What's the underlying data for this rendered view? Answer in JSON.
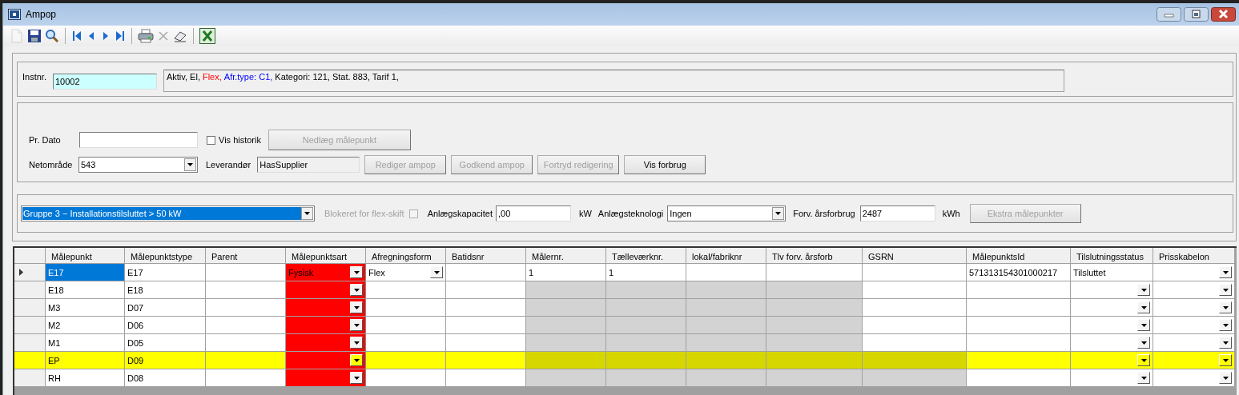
{
  "window": {
    "title": "Ampop"
  },
  "toolbar": [
    {
      "kind": "new",
      "disabled": true
    },
    {
      "kind": "save",
      "disabled": false
    },
    {
      "kind": "search",
      "disabled": false
    },
    {
      "kind": "separator"
    },
    {
      "kind": "first",
      "disabled": false
    },
    {
      "kind": "prev",
      "disabled": false
    },
    {
      "kind": "next",
      "disabled": false
    },
    {
      "kind": "last",
      "disabled": false
    },
    {
      "kind": "separator"
    },
    {
      "kind": "print",
      "disabled": false
    },
    {
      "kind": "delete",
      "disabled": true
    },
    {
      "kind": "eraser",
      "disabled": false
    },
    {
      "kind": "separator"
    },
    {
      "kind": "excel",
      "disabled": false
    }
  ],
  "installation": {
    "label": "Instnr.",
    "value": "10002",
    "summary": [
      {
        "text": "Aktiv, El,",
        "color": "#000000"
      },
      {
        "text": "Flex,",
        "color": "#ff0000"
      },
      {
        "text": "Afr.type: C1,",
        "color": "#0000ff"
      },
      {
        "text": "Kategori: 121, Stat. 883, Tarif 1,",
        "color": "#000000"
      }
    ]
  },
  "meter_point": {
    "date_label": "Pr. Dato",
    "history": {
      "label": "Vis historik",
      "checked": false
    },
    "close_button": {
      "label": "Nedlæg målepunkt",
      "disabled": true
    },
    "area_label": "Netområde",
    "area_value": "543",
    "supplier_label": "Leverandør",
    "supplier_value": "HasSupplier",
    "buttons": [
      {
        "label": "Rediger ampop",
        "disabled": true
      },
      {
        "label": "Godkend ampop",
        "disabled": true
      },
      {
        "label": "Fortryd redigering",
        "disabled": true
      },
      {
        "label": "Vis forbrug",
        "disabled": false
      }
    ]
  },
  "installation_details": {
    "group": "Gruppe 3 − Installationstilsluttet > 50 kW",
    "blocked": {
      "label": "Blokeret for flex-skift",
      "checked": false,
      "disabled": true
    },
    "capacity_label": "Anlægskapacitet",
    "capacity_value": ",00",
    "capacity_unit": "kW",
    "technology_label": "Anlægsteknologi",
    "technology_value": "Ingen",
    "consumption_label": "Forv. årsforbrug",
    "consumption_value": "2487",
    "consumption_unit": "kWh",
    "extra_button": {
      "label": "Ekstra målepunkter",
      "disabled": true
    }
  },
  "table": {
    "columns": [
      "Målepunkt",
      "Målepunktstype",
      "Parent",
      "Målepunktsart",
      "Afregningsform",
      "Batidsnr",
      "Målernr.",
      "Tælleværknr.",
      "lokal/fabriknr",
      "Tlv forv. årsforb",
      "GSRN",
      "MålepunktsId",
      "Tilslutningsstatus",
      "Prisskabelon"
    ],
    "rows": [
      {
        "current": true,
        "highlighted": false,
        "cells": [
          {
            "text": "E17",
            "selected": true,
            "disabled": false,
            "invalid": false,
            "dropdown": false
          },
          {
            "text": "E17",
            "selected": false,
            "disabled": false,
            "invalid": false,
            "dropdown": false
          },
          {
            "selected": false,
            "disabled": false,
            "invalid": false,
            "dropdown": false
          },
          {
            "text": "Fysisk",
            "selected": false,
            "disabled": false,
            "invalid": true,
            "dropdown": true
          },
          {
            "text": "Flex",
            "selected": false,
            "disabled": false,
            "invalid": false,
            "dropdown": true
          },
          {
            "selected": false,
            "disabled": false,
            "invalid": false,
            "dropdown": false
          },
          {
            "text": "1",
            "selected": false,
            "disabled": false,
            "invalid": false,
            "dropdown": false
          },
          {
            "text": "1",
            "selected": false,
            "disabled": false,
            "invalid": false,
            "dropdown": false
          },
          {
            "selected": false,
            "disabled": false,
            "invalid": false,
            "dropdown": false
          },
          {
            "selected": false,
            "disabled": false,
            "invalid": false,
            "dropdown": false
          },
          {
            "selected": false,
            "disabled": false,
            "invalid": false,
            "dropdown": false
          },
          {
            "text": "571313154301000217",
            "selected": false,
            "disabled": false,
            "invalid": false,
            "dropdown": false
          },
          {
            "text": "Tilsluttet",
            "selected": false,
            "disabled": false,
            "invalid": false,
            "dropdown": false
          },
          {
            "selected": false,
            "disabled": false,
            "invalid": false,
            "dropdown": true
          }
        ]
      },
      {
        "current": false,
        "highlighted": false,
        "cells": [
          {
            "text": "E18",
            "selected": false,
            "disabled": false,
            "invalid": false,
            "dropdown": false
          },
          {
            "text": "E18",
            "selected": false,
            "disabled": false,
            "invalid": false,
            "dropdown": false
          },
          {
            "selected": false,
            "disabled": false,
            "invalid": false,
            "dropdown": false
          },
          {
            "selected": false,
            "disabled": false,
            "invalid": true,
            "dropdown": true
          },
          {
            "selected": false,
            "disabled": false,
            "invalid": false,
            "dropdown": false
          },
          {
            "selected": false,
            "disabled": false,
            "invalid": false,
            "dropdown": false
          },
          {
            "selected": false,
            "disabled": true,
            "invalid": false,
            "dropdown": false
          },
          {
            "selected": false,
            "disabled": true,
            "invalid": false,
            "dropdown": false
          },
          {
            "selected": false,
            "disabled": true,
            "invalid": false,
            "dropdown": false
          },
          {
            "selected": false,
            "disabled": true,
            "invalid": false,
            "dropdown": false
          },
          {
            "selected": false,
            "disabled": false,
            "invalid": false,
            "dropdown": false
          },
          {
            "selected": false,
            "disabled": false,
            "invalid": false,
            "dropdown": false
          },
          {
            "selected": false,
            "disabled": false,
            "invalid": false,
            "dropdown": true
          },
          {
            "selected": false,
            "disabled": false,
            "invalid": false,
            "dropdown": true
          }
        ]
      },
      {
        "current": false,
        "highlighted": false,
        "cells": [
          {
            "text": "M3",
            "selected": false,
            "disabled": false,
            "invalid": false,
            "dropdown": false
          },
          {
            "text": "D07",
            "selected": false,
            "disabled": false,
            "invalid": false,
            "dropdown": false
          },
          {
            "selected": false,
            "disabled": false,
            "invalid": false,
            "dropdown": false
          },
          {
            "selected": false,
            "disabled": false,
            "invalid": true,
            "dropdown": true
          },
          {
            "selected": false,
            "disabled": false,
            "invalid": false,
            "dropdown": false
          },
          {
            "selected": false,
            "disabled": false,
            "invalid": false,
            "dropdown": false
          },
          {
            "selected": false,
            "disabled": true,
            "invalid": false,
            "dropdown": false
          },
          {
            "selected": false,
            "disabled": true,
            "invalid": false,
            "dropdown": false
          },
          {
            "selected": false,
            "disabled": true,
            "invalid": false,
            "dropdown": false
          },
          {
            "selected": false,
            "disabled": true,
            "invalid": false,
            "dropdown": false
          },
          {
            "selected": false,
            "disabled": false,
            "invalid": false,
            "dropdown": false
          },
          {
            "selected": false,
            "disabled": false,
            "invalid": false,
            "dropdown": false
          },
          {
            "selected": false,
            "disabled": false,
            "invalid": false,
            "dropdown": true
          },
          {
            "selected": false,
            "disabled": false,
            "invalid": false,
            "dropdown": true
          }
        ]
      },
      {
        "current": false,
        "highlighted": false,
        "cells": [
          {
            "text": "M2",
            "selected": false,
            "disabled": false,
            "invalid": false,
            "dropdown": false
          },
          {
            "text": "D06",
            "selected": false,
            "disabled": false,
            "invalid": false,
            "dropdown": false
          },
          {
            "selected": false,
            "disabled": false,
            "invalid": false,
            "dropdown": false
          },
          {
            "selected": false,
            "disabled": false,
            "invalid": true,
            "dropdown": true
          },
          {
            "selected": false,
            "disabled": false,
            "invalid": false,
            "dropdown": false
          },
          {
            "selected": false,
            "disabled": false,
            "invalid": false,
            "dropdown": false
          },
          {
            "selected": false,
            "disabled": true,
            "invalid": false,
            "dropdown": false
          },
          {
            "selected": false,
            "disabled": true,
            "invalid": false,
            "dropdown": false
          },
          {
            "selected": false,
            "disabled": true,
            "invalid": false,
            "dropdown": false
          },
          {
            "selected": false,
            "disabled": true,
            "invalid": false,
            "dropdown": false
          },
          {
            "selected": false,
            "disabled": false,
            "invalid": false,
            "dropdown": false
          },
          {
            "selected": false,
            "disabled": false,
            "invalid": false,
            "dropdown": false
          },
          {
            "selected": false,
            "disabled": false,
            "invalid": false,
            "dropdown": true
          },
          {
            "selected": false,
            "disabled": false,
            "invalid": false,
            "dropdown": true
          }
        ]
      },
      {
        "current": false,
        "highlighted": false,
        "cells": [
          {
            "text": "M1",
            "selected": false,
            "disabled": false,
            "invalid": false,
            "dropdown": false
          },
          {
            "text": "D05",
            "selected": false,
            "disabled": false,
            "invalid": false,
            "dropdown": false
          },
          {
            "selected": false,
            "disabled": false,
            "invalid": false,
            "dropdown": false
          },
          {
            "selected": false,
            "disabled": false,
            "invalid": true,
            "dropdown": true
          },
          {
            "selected": false,
            "disabled": false,
            "invalid": false,
            "dropdown": false
          },
          {
            "selected": false,
            "disabled": false,
            "invalid": false,
            "dropdown": false
          },
          {
            "selected": false,
            "disabled": true,
            "invalid": false,
            "dropdown": false
          },
          {
            "selected": false,
            "disabled": true,
            "invalid": false,
            "dropdown": false
          },
          {
            "selected": false,
            "disabled": true,
            "invalid": false,
            "dropdown": false
          },
          {
            "selected": false,
            "disabled": true,
            "invalid": false,
            "dropdown": false
          },
          {
            "selected": false,
            "disabled": false,
            "invalid": false,
            "dropdown": false
          },
          {
            "selected": false,
            "disabled": false,
            "invalid": false,
            "dropdown": false
          },
          {
            "selected": false,
            "disabled": false,
            "invalid": false,
            "dropdown": true
          },
          {
            "selected": false,
            "disabled": false,
            "invalid": false,
            "dropdown": true
          }
        ]
      },
      {
        "current": false,
        "highlighted": true,
        "cells": [
          {
            "text": "EP",
            "selected": false,
            "disabled": false,
            "invalid": false,
            "dropdown": false
          },
          {
            "text": "D09",
            "selected": false,
            "disabled": false,
            "invalid": false,
            "dropdown": false
          },
          {
            "selected": false,
            "disabled": false,
            "invalid": false,
            "dropdown": false
          },
          {
            "selected": false,
            "disabled": false,
            "invalid": true,
            "dropdown": true
          },
          {
            "selected": false,
            "disabled": false,
            "invalid": false,
            "dropdown": false
          },
          {
            "selected": false,
            "disabled": false,
            "invalid": false,
            "dropdown": false
          },
          {
            "selected": false,
            "disabled": true,
            "invalid": false,
            "dropdown": false
          },
          {
            "selected": false,
            "disabled": true,
            "invalid": false,
            "dropdown": false
          },
          {
            "selected": false,
            "disabled": true,
            "invalid": false,
            "dropdown": false
          },
          {
            "selected": false,
            "disabled": true,
            "invalid": false,
            "dropdown": false
          },
          {
            "selected": false,
            "disabled": true,
            "invalid": false,
            "dropdown": false
          },
          {
            "selected": false,
            "disabled": false,
            "invalid": false,
            "dropdown": false
          },
          {
            "selected": false,
            "disabled": false,
            "invalid": false,
            "dropdown": true
          },
          {
            "selected": false,
            "disabled": false,
            "invalid": false,
            "dropdown": true
          }
        ]
      },
      {
        "current": false,
        "highlighted": false,
        "cells": [
          {
            "text": "RH",
            "selected": false,
            "disabled": false,
            "invalid": false,
            "dropdown": false
          },
          {
            "text": "D08",
            "selected": false,
            "disabled": false,
            "invalid": false,
            "dropdown": false
          },
          {
            "selected": false,
            "disabled": false,
            "invalid": false,
            "dropdown": false
          },
          {
            "selected": false,
            "disabled": false,
            "invalid": true,
            "dropdown": true
          },
          {
            "selected": false,
            "disabled": false,
            "invalid": false,
            "dropdown": false
          },
          {
            "selected": false,
            "disabled": false,
            "invalid": false,
            "dropdown": false
          },
          {
            "selected": false,
            "disabled": true,
            "invalid": false,
            "dropdown": false
          },
          {
            "selected": false,
            "disabled": true,
            "invalid": false,
            "dropdown": false
          },
          {
            "selected": false,
            "disabled": true,
            "invalid": false,
            "dropdown": false
          },
          {
            "selected": false,
            "disabled": true,
            "invalid": false,
            "dropdown": false
          },
          {
            "selected": false,
            "disabled": true,
            "invalid": false,
            "dropdown": false
          },
          {
            "selected": false,
            "disabled": false,
            "invalid": false,
            "dropdown": false
          },
          {
            "selected": false,
            "disabled": false,
            "invalid": false,
            "dropdown": true
          },
          {
            "selected": false,
            "disabled": false,
            "invalid": false,
            "dropdown": true
          }
        ]
      }
    ]
  }
}
